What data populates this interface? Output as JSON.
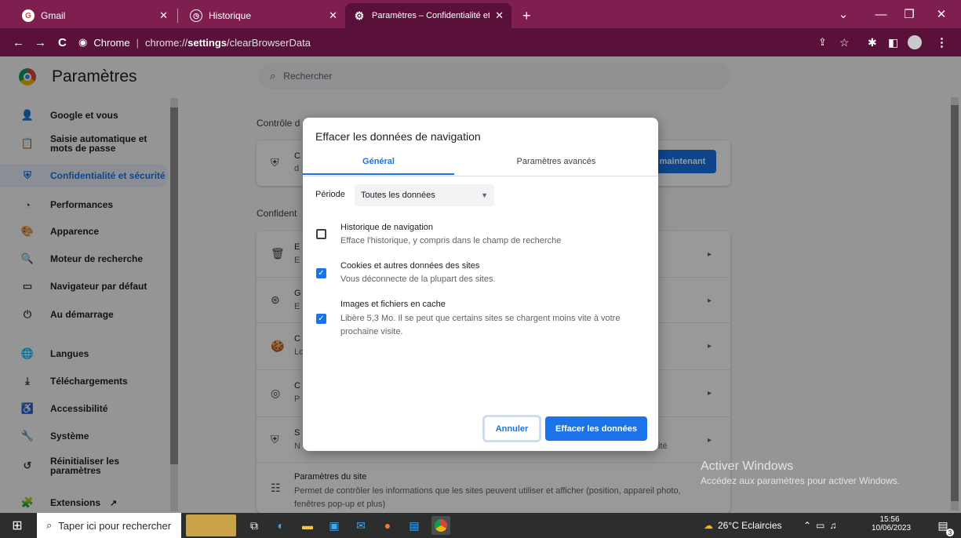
{
  "tabs": [
    {
      "title": "Gmail",
      "icon": "G"
    },
    {
      "title": "Historique",
      "icon": "clock"
    },
    {
      "title": "Paramètres – Confidentialité et s…",
      "icon": "gear"
    }
  ],
  "newtab": "+",
  "window_controls": {
    "dropdown": "⌄",
    "minimize": "—",
    "restore": "❐",
    "close": "✕"
  },
  "omnibox": {
    "site": "Chrome",
    "url_prefix": "chrome://",
    "url_bold": "settings",
    "url_rest": "/clearBrowserData"
  },
  "settings": {
    "title": "Paramètres",
    "search_placeholder": "Rechercher",
    "sidebar": [
      {
        "label": "Google et vous",
        "icon": "person-icon",
        "glyph": "👤"
      },
      {
        "label": "Saisie automatique et mots de passe",
        "icon": "clipboard-icon",
        "glyph": "📋"
      },
      {
        "label": "Confidentialité et sécurité",
        "icon": "shield-icon",
        "glyph": "⛨",
        "active": true
      },
      {
        "label": "Performances",
        "icon": "gauge-icon",
        "glyph": "◔"
      },
      {
        "label": "Apparence",
        "icon": "palette-icon",
        "glyph": "🎨"
      },
      {
        "label": "Moteur de recherche",
        "icon": "search-icon",
        "glyph": "🔍"
      },
      {
        "label": "Navigateur par défaut",
        "icon": "browser-icon",
        "glyph": "▭"
      },
      {
        "label": "Au démarrage",
        "icon": "power-icon",
        "glyph": "⏻"
      },
      {
        "label": "Langues",
        "icon": "globe-icon",
        "glyph": "🌐"
      },
      {
        "label": "Téléchargements",
        "icon": "download-icon",
        "glyph": "⤓"
      },
      {
        "label": "Accessibilité",
        "icon": "accessibility-icon",
        "glyph": "♿"
      },
      {
        "label": "Système",
        "icon": "wrench-icon",
        "glyph": "🔧"
      },
      {
        "label": "Réinitialiser les paramètres",
        "icon": "reset-icon",
        "glyph": "↺"
      },
      {
        "label": "Extensions",
        "icon": "puzzle-icon",
        "glyph": "🧩"
      }
    ],
    "section1": "Contrôle d",
    "section2": "Confident",
    "card1_text": "C",
    "card1_sub": "d",
    "card1_button": "maintenant",
    "rows": [
      {
        "t": "E",
        "s": "E",
        "icon": "trash-icon",
        "glyph": "🗑"
      },
      {
        "t": "G",
        "s": "E",
        "icon": "tune-icon",
        "glyph": "⊛"
      },
      {
        "t": "C",
        "s": "Lo",
        "icon": "cookie-icon",
        "glyph": "🍪"
      },
      {
        "t": "C",
        "s": "P",
        "icon": "fingerprint-icon",
        "glyph": "◎"
      },
      {
        "t": "S",
        "s": "N",
        "icon": "shield-outline-icon",
        "glyph": "⛨",
        "tail": "ité"
      }
    ],
    "site_settings": {
      "title": "Paramètres du site",
      "desc": "Permet de contrôler les informations que les sites peuvent utiliser et afficher (position, appareil photo, fenêtres pop-up et plus)"
    }
  },
  "dialog": {
    "title": "Effacer les données de navigation",
    "tab_general": "Général",
    "tab_advanced": "Paramètres avancés",
    "period_label": "Période",
    "period_value": "Toutes les données",
    "options": [
      {
        "title": "Historique de navigation",
        "desc": "Efface l'historique, y compris dans le champ de recherche",
        "checked": false
      },
      {
        "title": "Cookies et autres données des sites",
        "desc": "Vous déconnecte de la plupart des sites.",
        "checked": true
      },
      {
        "title": "Images et fichiers en cache",
        "desc": "Libère 5,3 Mo. Il se peut que certains sites se chargent moins vite à votre prochaine visite.",
        "checked": true
      }
    ],
    "cancel": "Annuler",
    "confirm": "Effacer les données"
  },
  "watermark": {
    "line1": "Activer Windows",
    "line2": "Accédez aux paramètres pour activer Windows."
  },
  "taskbar": {
    "search_placeholder": "Taper ici pour rechercher",
    "weather": "26°C Eclaircies",
    "time": "15:56",
    "date": "10/06/2023",
    "notif_count": "3"
  },
  "colors": {
    "tabstrip": "#7e1f4f",
    "toolbar": "#5a1139",
    "accent": "#1a73e8"
  }
}
